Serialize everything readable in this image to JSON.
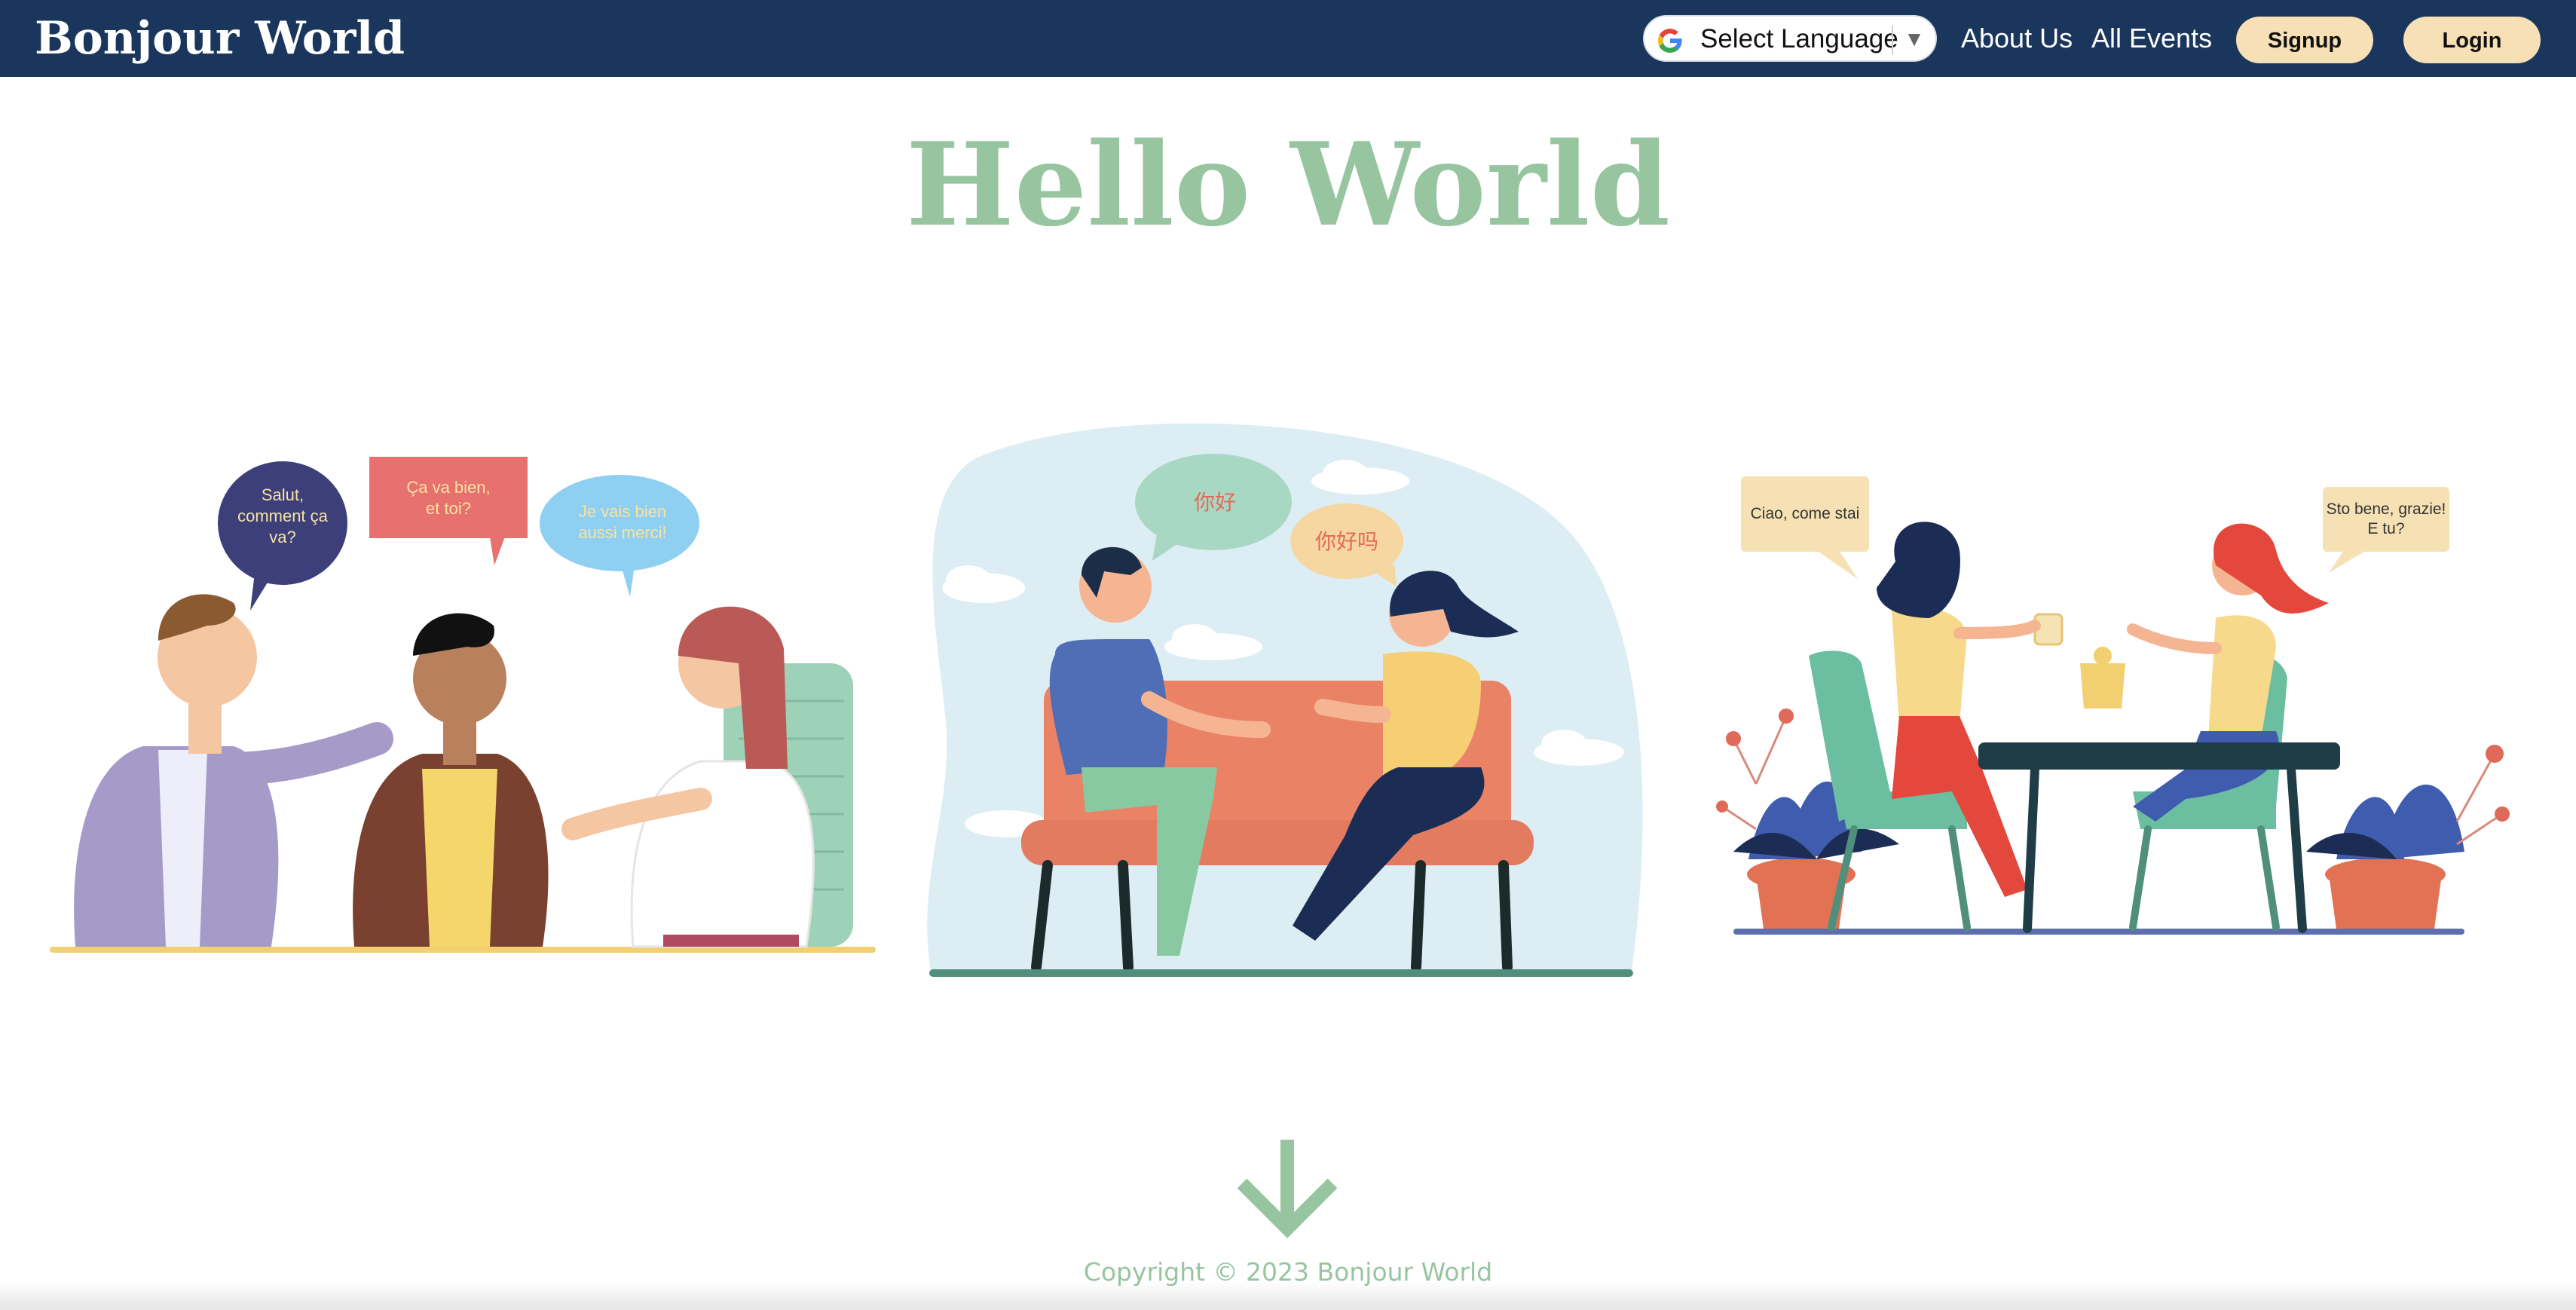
{
  "navbar": {
    "brand": "Bonjour World",
    "language_select": {
      "label": "Select Language",
      "icon": "google-g-icon",
      "dropdown_icon": "triangle-down-icon"
    },
    "links": [
      "About Us",
      "All Events"
    ],
    "signup_label": "Signup",
    "login_label": "Login"
  },
  "hero": {
    "title": "Hello World"
  },
  "illustrations": {
    "group_conversation": {
      "bubbles": [
        "Salut, comment ça va?",
        "Ça va bien, et toi?",
        "Je vais bien aussi merci!"
      ]
    },
    "couch_conversation": {
      "bubbles": [
        "你好",
        "你好吗"
      ]
    },
    "cafe_conversation": {
      "bubbles": [
        "Ciao, come stai",
        "Sto bene, grazie! E tu?"
      ]
    }
  },
  "scroll_icon": "arrow-down-icon",
  "footer": {
    "copyright": "Copyright © 2023 Bonjour World"
  },
  "colors": {
    "navbar": "#1b365d",
    "accent_green": "#97c5a0",
    "button_cream": "#f7dfb6",
    "text_white": "#ffffff"
  }
}
